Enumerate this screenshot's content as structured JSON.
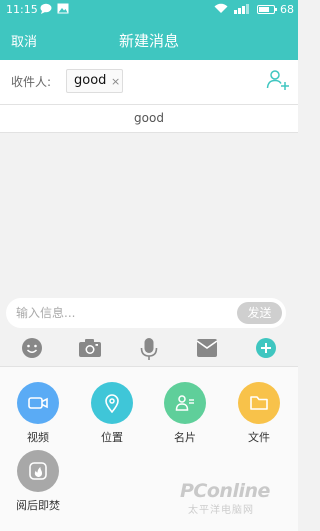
{
  "status_bar": {
    "time": "11:15",
    "battery": "68",
    "battery_fraction": 0.68
  },
  "header": {
    "cancel_label": "取消",
    "title": "新建消息"
  },
  "recipient": {
    "label": "收件人:",
    "chip_text": "good",
    "chip_remove": "×"
  },
  "suggestion": {
    "text": "good"
  },
  "composer": {
    "placeholder": "输入信息...",
    "send_label": "发送"
  },
  "toolbar": {
    "icons": [
      "emoji-icon",
      "camera-icon",
      "microphone-icon",
      "mail-icon",
      "plus-icon"
    ]
  },
  "attachments": [
    {
      "label": "视频",
      "icon": "video-icon",
      "color": "#5aabf5"
    },
    {
      "label": "位置",
      "icon": "location-icon",
      "color": "#3fc6d8"
    },
    {
      "label": "名片",
      "icon": "contact-card-icon",
      "color": "#5fcf9a"
    },
    {
      "label": "文件",
      "icon": "folder-icon",
      "color": "#f8c24a"
    },
    {
      "label": "阅后即焚",
      "icon": "burn-after-reading-icon",
      "color": "#a8a8a8"
    }
  ],
  "watermark": {
    "text": "PConline",
    "sub": "太平洋电脑网"
  },
  "colors": {
    "accent": "#3fc6c0",
    "send_disabled": "#cfcfcf"
  }
}
